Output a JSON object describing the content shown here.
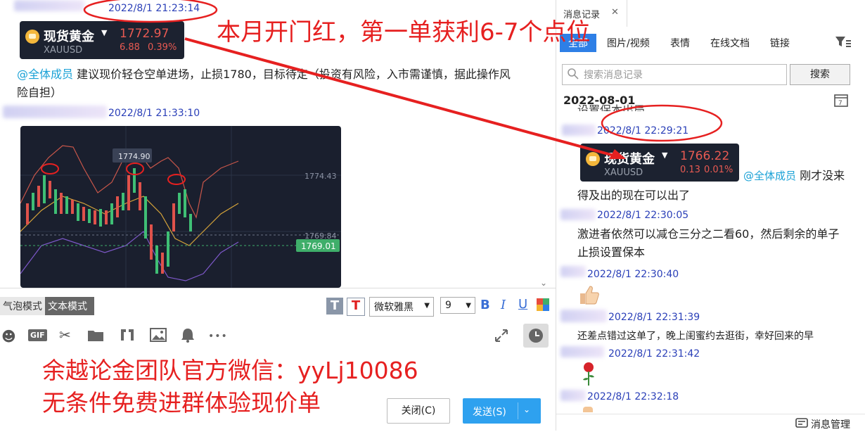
{
  "chat": {
    "msg1_time": "2022/8/1 21:23:14",
    "card1": {
      "name": "现货黄金",
      "symbol": "XAUUSD",
      "price": "1772.97",
      "change": "6.88",
      "pct": "0.39%"
    },
    "msg1_mention": "@全体成员",
    "msg1_text_a": " 建议现价轻仓空单进场，止损1780，目标待定（投资有风险，入市需谨慎，据此操作风",
    "msg1_text_b": "险自担）",
    "msg2_time": "2022/8/1 21:33:10",
    "chart_labels": {
      "peak": "1774.90",
      "level_hi": "1774.43",
      "level_mid": "1769.84",
      "current": "1769.01"
    }
  },
  "toolbar": {
    "bubble_mode": "气泡模式",
    "text_mode": "文本模式",
    "font_name": "微软雅黑",
    "font_size": "9",
    "bold": "B",
    "italic": "I",
    "underline": "U",
    "t1": "T",
    "t2": "T",
    "gif": "GIF",
    "more": "•••"
  },
  "actions": {
    "close": "关闭(C)",
    "send": "发送(S)"
  },
  "annotations": {
    "top": "本月开门红，第一单获利6-7个点位",
    "bottom1": "余越论金团队官方微信：yyLj10086",
    "bottom2": "无条件免费进群体验现价单"
  },
  "history": {
    "title": "消息记录",
    "tabs": [
      "全部",
      "图片/视频",
      "表情",
      "在线文档",
      "链接"
    ],
    "search_placeholder": "搜索消息记录",
    "search_button": "搜索",
    "date": "2022-08-01",
    "partial_text": "设置保本出局",
    "entries": [
      {
        "time": "2022/8/1 22:29:21"
      },
      {
        "time": "2022/8/1 22:30:05",
        "text_a": "激进者依然可以减仓三分之二看60，然后剩余的单子",
        "text_b": "止损设置保本"
      },
      {
        "time": "2022/8/1 22:30:40"
      },
      {
        "time": "2022/8/1 22:31:39",
        "text": "还差点错过这单了，晚上闺蜜约去逛街，幸好回来的早"
      },
      {
        "time": "2022/8/1 22:31:42"
      },
      {
        "time": "2022/8/1 22:32:18"
      }
    ],
    "card2": {
      "name": "现货黄金",
      "symbol": "XAUUSD",
      "price": "1766.22",
      "change": "0.13",
      "pct": "0.01%"
    },
    "card2_mention": "@全体成员",
    "card2_text_a": " 刚才没来",
    "card2_text_b": "得及出的现在可以出了",
    "manage": "消息管理"
  },
  "colors": {
    "accent": "#2e7fe6",
    "annotation": "#e62020",
    "price_red": "#e85a52"
  }
}
